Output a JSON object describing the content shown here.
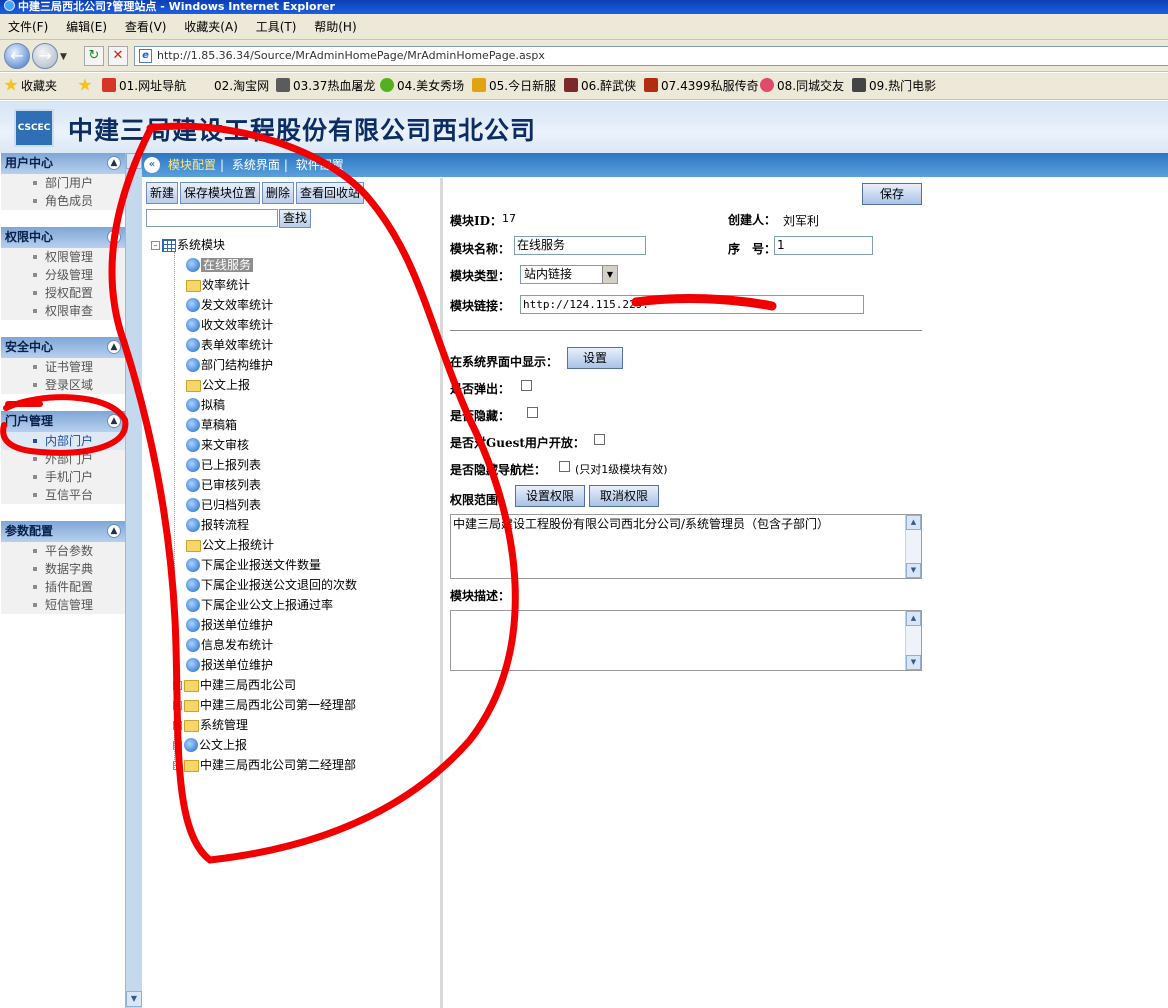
{
  "window": {
    "title": "中建三局西北公司?管理站点 - Windows Internet Explorer"
  },
  "menubar": [
    "文件(F)",
    "编辑(E)",
    "查看(V)",
    "收藏夹(A)",
    "工具(T)",
    "帮助(H)"
  ],
  "address": {
    "url": "http://1.85.36.34/Source/MrAdminHomePage/MrAdminHomePage.aspx"
  },
  "favorites": {
    "label": "收藏夹",
    "items": [
      "01.网址导航",
      "02.淘宝网",
      "03.37热血屠龙",
      "04.美女秀场",
      "05.今日新服",
      "06.醉武侠",
      "07.4399私服传奇",
      "08.同城交友",
      "09.热门电影"
    ]
  },
  "header": {
    "company": "中建三局建设工程股份有限公司西北公司"
  },
  "left_menu": {
    "groups": [
      {
        "title": "用户中心",
        "items": [
          "部门用户",
          "角色成员"
        ]
      },
      {
        "title": "权限中心",
        "items": [
          "权限管理",
          "分级管理",
          "授权配置",
          "权限审查"
        ]
      },
      {
        "title": "安全中心",
        "items": [
          "证书管理",
          "登录区域"
        ]
      },
      {
        "title": "门户管理",
        "items": [
          "内部门户",
          "外部门户",
          "手机门户",
          "互信平台"
        ]
      },
      {
        "title": "参数配置",
        "items": [
          "平台参数",
          "数据字典",
          "插件配置",
          "短信管理"
        ]
      }
    ]
  },
  "tabs": [
    "模块配置",
    "系统界面",
    "软件配置"
  ],
  "tree_toolbar": {
    "new": "新建",
    "save_pos": "保存模块位置",
    "delete": "删除",
    "recycle": "查看回收站",
    "search": "查找"
  },
  "tree": {
    "root": "系统模块",
    "nodes": [
      {
        "label": "在线服务",
        "icon": "ie-icon"
      },
      {
        "label": "效率统计",
        "icon": "folder-icon"
      },
      {
        "label": "发文效率统计",
        "icon": "ie-icon"
      },
      {
        "label": "收文效率统计",
        "icon": "ie-icon"
      },
      {
        "label": "表单效率统计",
        "icon": "ie-icon"
      },
      {
        "label": "部门结构维护",
        "icon": "ie-icon"
      },
      {
        "label": "公文上报",
        "icon": "folder-icon"
      },
      {
        "label": "拟稿",
        "icon": "ie-icon"
      },
      {
        "label": "草稿箱",
        "icon": "ie-icon"
      },
      {
        "label": "来文审核",
        "icon": "ie-icon"
      },
      {
        "label": "已上报列表",
        "icon": "ie-icon"
      },
      {
        "label": "已审核列表",
        "icon": "ie-icon"
      },
      {
        "label": "已归档列表",
        "icon": "ie-icon"
      },
      {
        "label": "报转流程",
        "icon": "ie-icon"
      },
      {
        "label": "公文上报统计",
        "icon": "folder-icon"
      },
      {
        "label": "下属企业报送文件数量",
        "icon": "ie-icon"
      },
      {
        "label": "下属企业报送公文退回的次数",
        "icon": "ie-icon"
      },
      {
        "label": "下属企业公文上报通过率",
        "icon": "ie-icon"
      },
      {
        "label": "报送单位维护",
        "icon": "ie-icon"
      },
      {
        "label": "信息发布统计",
        "icon": "ie-icon"
      },
      {
        "label": "报送单位维护",
        "icon": "ie-icon"
      },
      {
        "label": "中建三局西北公司",
        "icon": "folder-icon"
      },
      {
        "label": "中建三局西北公司第一经理部",
        "icon": "folder-icon"
      },
      {
        "label": "系统管理",
        "icon": "folder-icon"
      },
      {
        "label": "公文上报",
        "icon": "ie-icon"
      },
      {
        "label": "中建三局西北公司第二经理部",
        "icon": "folder-icon"
      }
    ]
  },
  "form": {
    "save": "保存",
    "module_id_label": "模块ID：",
    "module_id": "17",
    "creator_label": "创建人：",
    "creator": "刘军利",
    "name_label": "模块名称：",
    "name": "在线服务",
    "order_label": "序　号：",
    "order": "1",
    "type_label": "模块类型：",
    "type": "站内链接",
    "link_label": "模块链接：",
    "link": "http://124.115.229.",
    "show_label": "在系统界面中显示：",
    "show_btn": "设置",
    "popup_label": "是否弹出：",
    "hidden_label": "是否隐藏：",
    "guest_label": "是否对Guest用户开放：",
    "hide_nav_label": "是否隐藏导航栏：",
    "hide_nav_note": "(只对1级模块有效)",
    "perm_label": "权限范围：",
    "perm_set": "设置权限",
    "perm_cancel": "取消权限",
    "perm_value": "中建三局建设工程股份有限公司西北分公司/系统管理员（包含子部门）",
    "desc_label": "模块描述：",
    "desc_value": ""
  }
}
